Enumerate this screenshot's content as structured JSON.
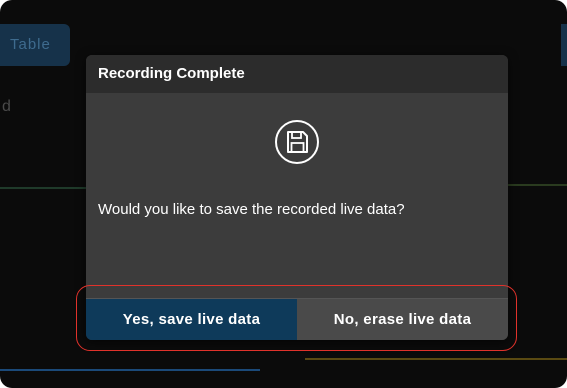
{
  "background": {
    "tab_label": "Table",
    "side_label": "d"
  },
  "dialog": {
    "title": "Recording Complete",
    "icon": "floppy-disk-save-icon",
    "message": "Would you like to save the recorded live data?",
    "buttons": {
      "yes_label": "Yes, save live data",
      "no_label": "No, erase live data"
    }
  },
  "colors": {
    "primary_button": "#0e3a5a",
    "secondary_button": "#4a4a4a",
    "dialog_body": "#3c3c3c",
    "dialog_header": "#2c2c2c",
    "annotation_outline": "#e0322b"
  }
}
